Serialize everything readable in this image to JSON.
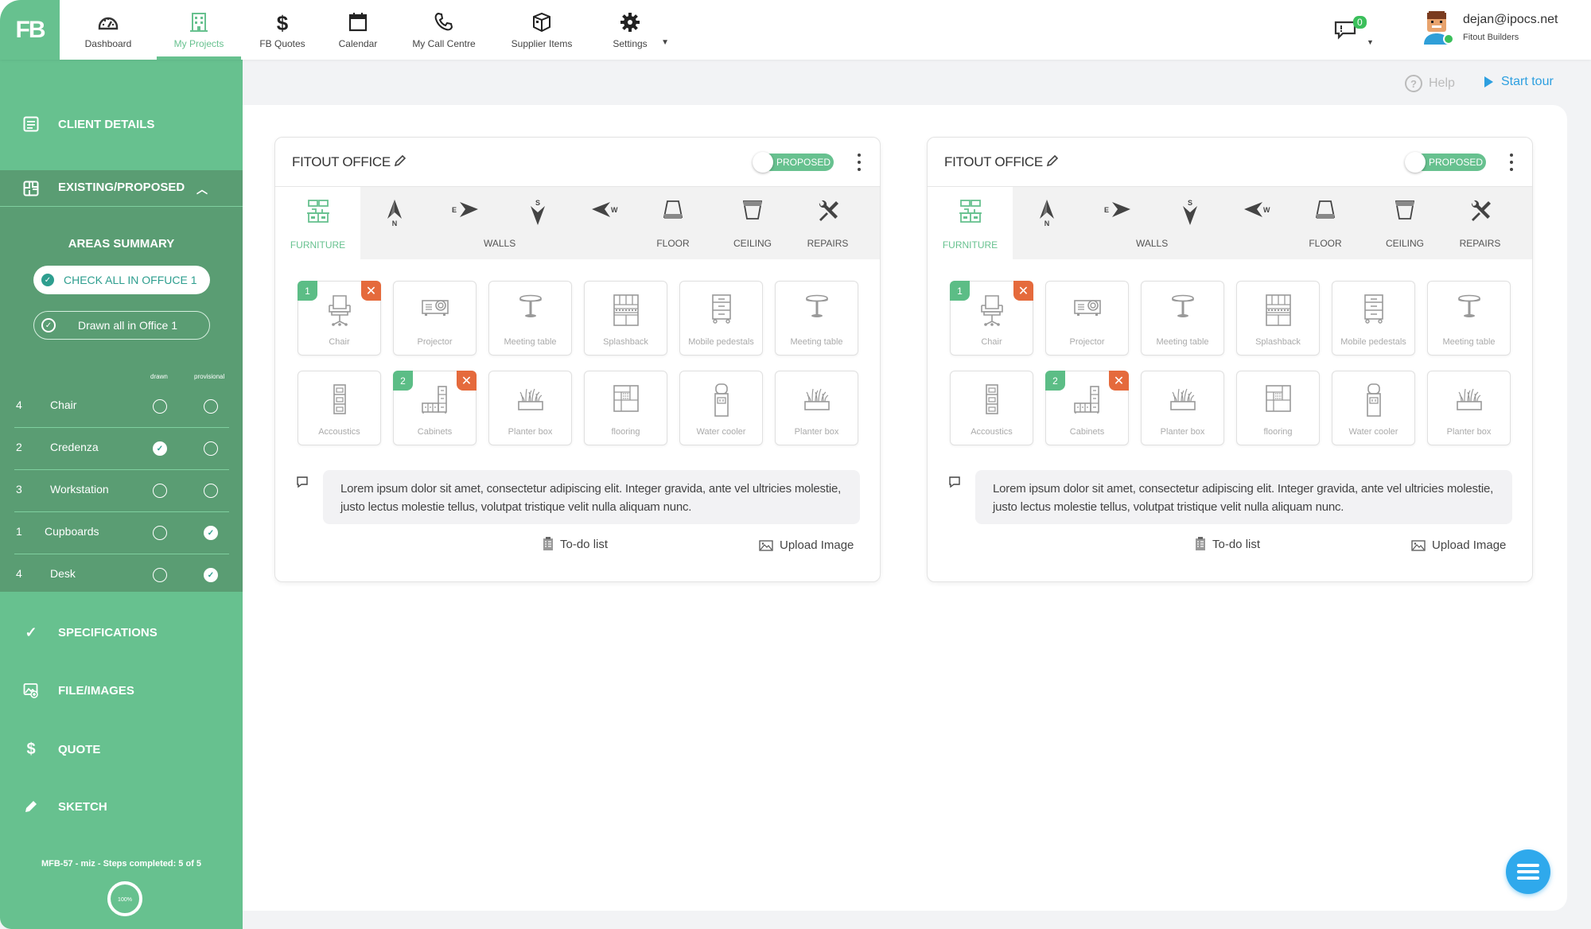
{
  "brand": {
    "logo_text": "FB",
    "accent": "#67c18f",
    "accent_dark": "#5a9d73",
    "danger": "#e56a3c",
    "info": "#2fa9ec"
  },
  "nav": {
    "items": [
      {
        "label": "Dashboard",
        "icon": "gauge-icon",
        "active": false
      },
      {
        "label": "My Projects",
        "icon": "building-icon",
        "active": true
      },
      {
        "label": "FB Quotes",
        "icon": "dollar-icon",
        "active": false
      },
      {
        "label": "Calendar",
        "icon": "calendar-icon",
        "active": false
      },
      {
        "label": "My Call Centre",
        "icon": "phone-icon",
        "active": false
      },
      {
        "label": "Supplier Items",
        "icon": "box-icon",
        "active": false
      },
      {
        "label": "Settings",
        "icon": "gear-icon",
        "active": false
      }
    ]
  },
  "notifications": {
    "count": "0"
  },
  "user": {
    "email": "dejan@ipocs.net",
    "company": "Fitout Builders"
  },
  "sidebar": {
    "client_details": "CLIENT DETAILS",
    "existing_proposed": "EXISTING/PROPOSED",
    "areas_summary": "AREAS SUMMARY",
    "check_all": "CHECK ALL IN OFFUCE 1",
    "drawn_all": "Drawn all in Office 1",
    "col_drawn": "drawn",
    "col_provisional": "provisional",
    "areas": [
      {
        "count": "4",
        "name": "Chair",
        "drawn": false,
        "provisional": false
      },
      {
        "count": "2",
        "name": "Credenza",
        "drawn": true,
        "provisional": false
      },
      {
        "count": "3",
        "name": "Workstation",
        "drawn": false,
        "provisional": false
      },
      {
        "count": "1",
        "name": "Cupboards",
        "drawn": false,
        "provisional": true
      },
      {
        "count": "4",
        "name": "Desk",
        "drawn": false,
        "provisional": true
      }
    ],
    "specifications": "SPECIFICATIONS",
    "file_images": "FILE/IMAGES",
    "quote": "QUOTE",
    "sketch": "SKETCH",
    "progress_text": "MFB-57 - miz - Steps completed: 5 of 5",
    "progress_percent": 100,
    "progress_label": "100%"
  },
  "help": {
    "help_label": "Help",
    "tour_label": "Start tour"
  },
  "cards": [
    {
      "title": "FITOUT OFFICE",
      "toggle_label": "PROPOSED",
      "tabs": {
        "furniture": "FURNITURE",
        "walls": "WALLS",
        "floor": "FLOOR",
        "ceiling": "CEILING",
        "repairs": "REPAIRS",
        "n": "N",
        "e": "E",
        "s": "S",
        "w": "W"
      },
      "tiles": [
        {
          "name": "Chair",
          "icon": "chair",
          "count": "1",
          "removable": true
        },
        {
          "name": "Projector",
          "icon": "projector"
        },
        {
          "name": "Meeting table",
          "icon": "table"
        },
        {
          "name": "Splashback",
          "icon": "splashback"
        },
        {
          "name": "Mobile pedestals",
          "icon": "pedestal"
        },
        {
          "name": "Meeting table",
          "icon": "table"
        },
        {
          "name": "Accoustics",
          "icon": "acoustics"
        },
        {
          "name": "Cabinets",
          "icon": "cabinets",
          "count": "2",
          "removable": true
        },
        {
          "name": "Planter box",
          "icon": "planter"
        },
        {
          "name": "flooring",
          "icon": "flooring"
        },
        {
          "name": "Water cooler",
          "icon": "cooler"
        },
        {
          "name": "Planter box",
          "icon": "planter"
        }
      ],
      "comment": "Lorem ipsum dolor sit amet, consectetur adipiscing elit. Integer gravida, ante vel ultricies molestie, justo lectus molestie tellus, volutpat tristique velit nulla aliquam nunc.",
      "todo_label": "To-do list",
      "upload_label": "Upload Image"
    },
    {
      "title": "FITOUT OFFICE",
      "toggle_label": "PROPOSED",
      "tabs": {
        "furniture": "FURNITURE",
        "walls": "WALLS",
        "floor": "FLOOR",
        "ceiling": "CEILING",
        "repairs": "REPAIRS",
        "n": "N",
        "e": "E",
        "s": "S",
        "w": "W"
      },
      "tiles": [
        {
          "name": "Chair",
          "icon": "chair",
          "count": "1",
          "removable": true
        },
        {
          "name": "Projector",
          "icon": "projector"
        },
        {
          "name": "Meeting table",
          "icon": "table"
        },
        {
          "name": "Splashback",
          "icon": "splashback"
        },
        {
          "name": "Mobile pedestals",
          "icon": "pedestal"
        },
        {
          "name": "Meeting table",
          "icon": "table"
        },
        {
          "name": "Accoustics",
          "icon": "acoustics"
        },
        {
          "name": "Cabinets",
          "icon": "cabinets",
          "count": "2",
          "removable": true
        },
        {
          "name": "Planter box",
          "icon": "planter"
        },
        {
          "name": "flooring",
          "icon": "flooring"
        },
        {
          "name": "Water cooler",
          "icon": "cooler"
        },
        {
          "name": "Planter box",
          "icon": "planter"
        }
      ],
      "comment": "Lorem ipsum dolor sit amet, consectetur adipiscing elit. Integer gravida, ante vel ultricies molestie, justo lectus molestie tellus, volutpat tristique velit nulla aliquam nunc.",
      "todo_label": "To-do list",
      "upload_label": "Upload Image"
    }
  ]
}
